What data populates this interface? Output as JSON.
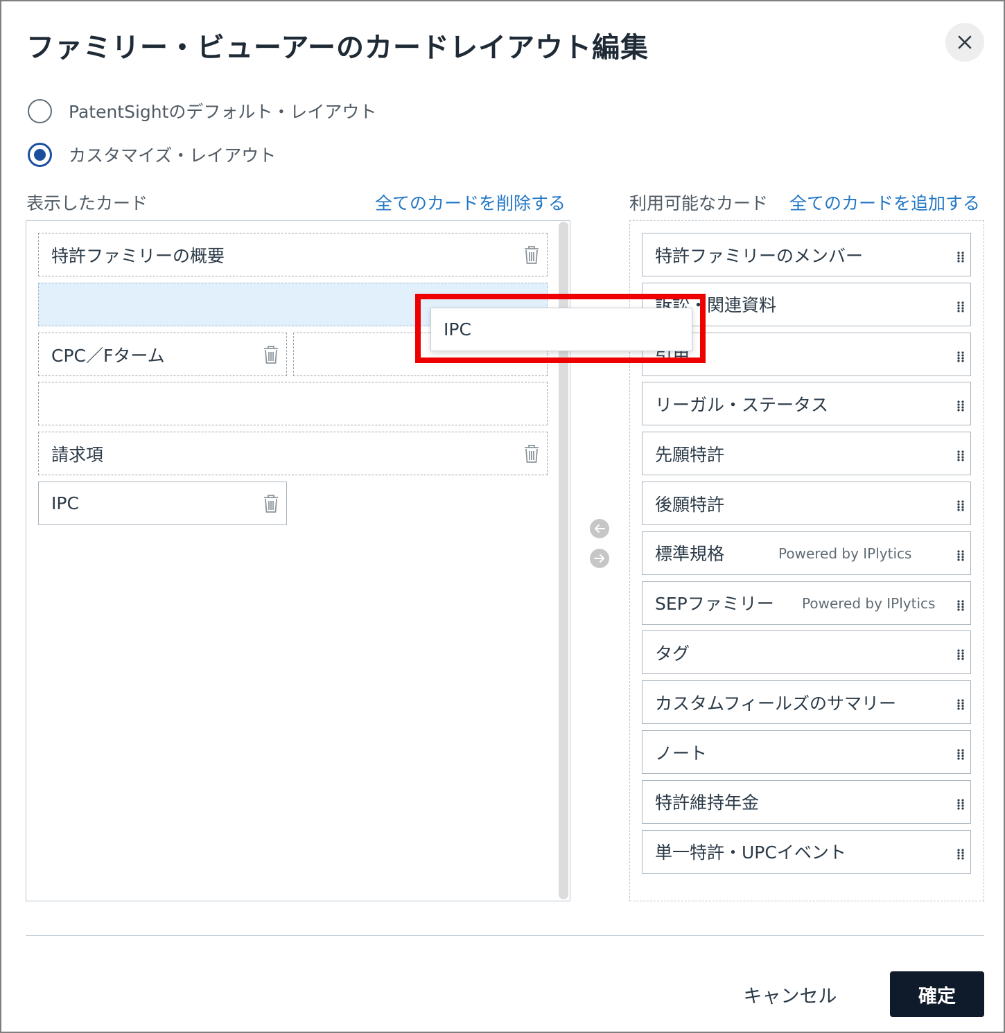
{
  "dialog": {
    "title": "ファミリー・ビューアーのカードレイアウト編集",
    "close_icon": "close-icon"
  },
  "layout_options": [
    {
      "label": "PatentSightのデフォルト・レイアウト",
      "selected": false
    },
    {
      "label": "カスタマイズ・レイアウト",
      "selected": true
    }
  ],
  "displayed": {
    "heading": "表示したカード",
    "remove_all_label": "全てのカードを削除する",
    "cards": [
      {
        "label": "特許ファミリーの概要"
      },
      {
        "label": ""
      },
      {
        "label": "CPC／Fターム"
      },
      {
        "label": ""
      },
      {
        "label": ""
      },
      {
        "label": "請求項"
      },
      {
        "label": "IPC"
      }
    ]
  },
  "available": {
    "heading": "利用可能なカード",
    "add_all_label": "全てのカードを追加する",
    "cards": [
      {
        "label": "特許ファミリーのメンバー",
        "powered": ""
      },
      {
        "label": "訴訟・関連資料",
        "powered": ""
      },
      {
        "label": "引用",
        "powered": ""
      },
      {
        "label": "リーガル・ステータス",
        "powered": ""
      },
      {
        "label": "先願特許",
        "powered": ""
      },
      {
        "label": "後願特許",
        "powered": ""
      },
      {
        "label": "標準規格",
        "powered": "Powered by IPlytics"
      },
      {
        "label": "SEPファミリー",
        "powered": "Powered by IPlytics"
      },
      {
        "label": "タグ",
        "powered": ""
      },
      {
        "label": "カスタムフィールズのサマリー",
        "powered": ""
      },
      {
        "label": "ノート",
        "powered": ""
      },
      {
        "label": "特許維持年金",
        "powered": ""
      },
      {
        "label": "単一特許・UPCイベント",
        "powered": ""
      }
    ]
  },
  "drag_ghost": {
    "label": "IPC"
  },
  "footer": {
    "cancel_label": "キャンセル",
    "confirm_label": "確定"
  },
  "colors": {
    "link": "#2277c4",
    "radio_selected": "#1b4e9c",
    "confirm_bg": "#0f1b2a",
    "placeholder_bg": "#e2f0fb",
    "highlight": "#ee0000"
  }
}
